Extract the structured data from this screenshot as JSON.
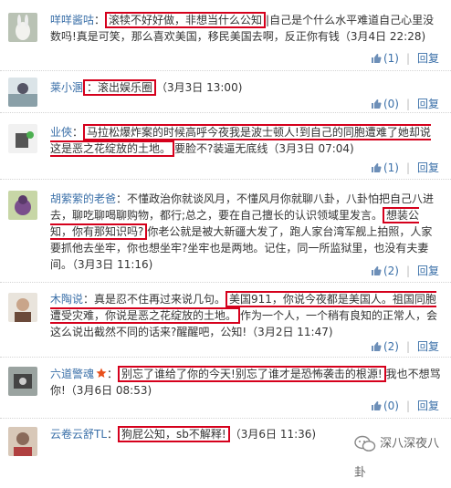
{
  "comments": [
    {
      "user": "咩咩酱咕",
      "segments": [
        "：",
        "滚犊不好好做，非想当什么公知",
        "|自己是个什么水平难道自己心里没数吗!真是可笑，那么喜欢美国，移民美国去啊，反正你有钱（3月4日 22:28)"
      ],
      "likes": "(1)",
      "reply": "回复"
    },
    {
      "user": "莱小溷",
      "segments": [
        "：滚出娱乐圈",
        "（3月3日 13:00)"
      ],
      "likes": "(0)",
      "reply": "回复"
    },
    {
      "user": "业俠",
      "segments": [
        "：",
        "马拉松爆炸案的时候高呼今夜我是波士顿人!到自己的同胞遭难了她却说这是恶之花绽放的土地。",
        "要脸不?装逼无底线（3月3日 07:04)"
      ],
      "likes": "(1)",
      "reply": "回复"
    },
    {
      "user": "胡萦萦的老爸",
      "segments": [
        "：不懂政治你就谈风月，不懂风月你就聊八卦，八卦怕把自己八进去，聊吃聊喝聊购物，都行;总之，要在自己擅长的认识领域里发言。",
        "想装公知，你有那知识吗?",
        "你老公就是被大新疆大发了，跑人家台湾军舰上拍照，人家要抓他去坐牢，你也想坐牢?坐牢也是两地。记住，同一所监狱里，也没有夫妻间。（3月3日 11:16)"
      ],
      "likes": "(2)",
      "reply": "回复"
    },
    {
      "user": "木陶说",
      "segments": [
        "：真是忍不住再过来说几句。",
        "美国911，你说今夜都是美国人。祖国同胞遭受灾难，你说是恶之花绽放的土地。",
        "作为一个人，一个稍有良知的正常人，会这么说出截然不同的话来?醒醒吧，公知!（3月2日 11:47)"
      ],
      "likes": "(2)",
      "reply": "回复"
    },
    {
      "user": "六道警魂",
      "segments": [
        "：",
        "别忘了谁给了你的今天!别忘了谁才是恐怖袭击的根源!",
        "我也不想骂你!（3月6日 08:53)"
      ],
      "likes": "(0)",
      "reply": "回复"
    },
    {
      "user": "云卷云舒TL",
      "segments": [
        "：",
        "狗屁公知，sb不解释!",
        "（3月6日 11:36)"
      ],
      "likes": "",
      "reply": ""
    }
  ],
  "watermark": "深八深夜八卦",
  "colors": {
    "username": "#3a6fa8",
    "highlight_box": "#d5001c",
    "text": "#333333"
  }
}
